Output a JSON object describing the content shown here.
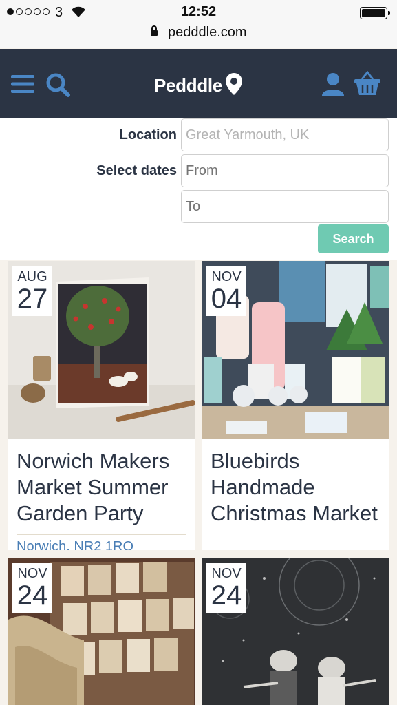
{
  "status_bar": {
    "carrier": "3",
    "time": "12:52"
  },
  "browser": {
    "url": "pedddle.com"
  },
  "navbar": {
    "logo": "Pedddle",
    "icons": [
      "menu-icon",
      "search-icon",
      "user-icon",
      "basket-icon"
    ]
  },
  "search_form": {
    "location_label": "Location",
    "location_value": "Great Yarmouth, UK",
    "dates_label": "Select dates",
    "from_placeholder": "From",
    "to_placeholder": "To",
    "search_button": "Search"
  },
  "events": [
    {
      "month": "AUG",
      "day": "27",
      "title": "Norwich Makers Market Summer Garden Party",
      "location": "Norwich, NR2 1RQ"
    },
    {
      "month": "NOV",
      "day": "04",
      "title": "Bluebirds Handmade Christmas Market",
      "location": ""
    },
    {
      "month": "NOV",
      "day": "24",
      "title": "",
      "location": ""
    },
    {
      "month": "NOV",
      "day": "24",
      "title": "",
      "location": ""
    }
  ],
  "colors": {
    "navbar": "#2b3444",
    "accent_blue": "#4a86c5",
    "search_button": "#6fcab2",
    "link": "#4a7eb5"
  }
}
